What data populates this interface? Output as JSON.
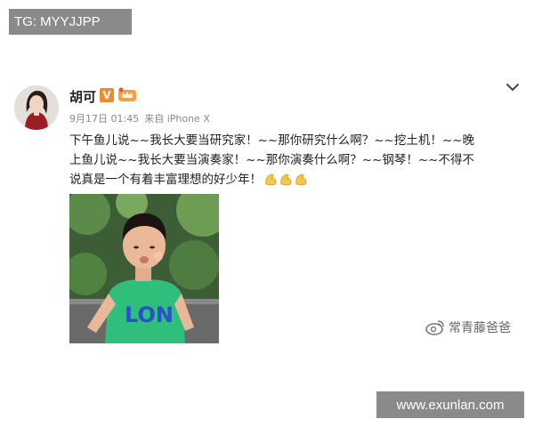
{
  "overlay": {
    "tg_label": "TG: MYYJJPP",
    "site_label": "www.exunlan.com"
  },
  "post": {
    "username": "胡可",
    "vip_badge": "V",
    "date": "9月17日 01:45",
    "source": "来自 iPhone X",
    "lines": [
      "下午鱼儿说~~我长大要当研究家！~~那你研究什么啊？~~挖土机！~~晚",
      "上鱼儿说~~我长大要当演奏家！~~那你演奏什么啊？~~钢琴！~~不得不",
      "说真是一个有着丰富理想的好少年！"
    ],
    "emojis": [
      "strong-arm-emoji",
      "strong-arm-emoji",
      "strong-arm-emoji"
    ],
    "photo_shirt_text": "LON"
  },
  "watermark": {
    "account": "常青藤爸爸"
  },
  "colors": {
    "badge_orange": "#f08a2a",
    "overlay_gray": "#8a8a8a",
    "shirt_green": "#2fbf7a",
    "shirt_text_blue": "#2a4fd0"
  }
}
